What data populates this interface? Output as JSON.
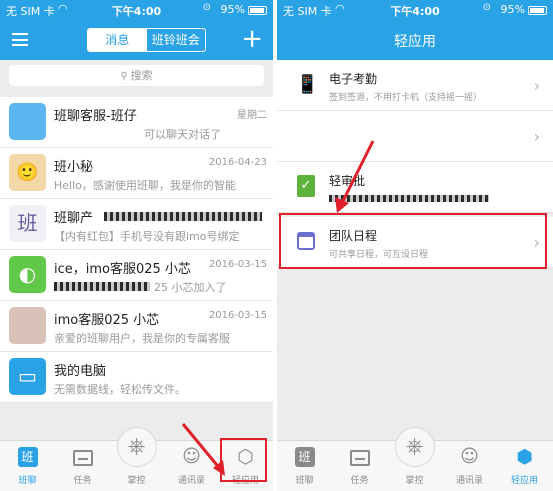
{
  "status_bar": {
    "carrier": "无 SIM 卡",
    "time": "下午4:00",
    "battery": "95%"
  },
  "left": {
    "tabs": [
      "消息",
      "班铃班会"
    ],
    "search_placeholder": "搜索",
    "chats": [
      {
        "name": "班聊客服-班仔",
        "date": "星期二",
        "preview": "可以聊天对话了",
        "avatar_color": "#5bb6ef",
        "avatar_text": ""
      },
      {
        "name": "班小秘",
        "date": "2016-04-23",
        "preview": "Hello，感谢使用班聊，我是你的智能",
        "avatar_color": "#f4d9a8",
        "avatar_text": "🙂"
      },
      {
        "name": "班聊产",
        "date": "",
        "preview": "【内有红包】手机号没有跟imo号绑定",
        "avatar_color": "#f2f0f6",
        "avatar_text": "班"
      },
      {
        "name": "ice，imo客服025 小芯",
        "date": "2016-03-15",
        "preview": "25 小芯加入了",
        "avatar_color": "#61c84a",
        "avatar_text": "◐"
      },
      {
        "name": "imo客服025 小芯",
        "date": "2016-03-15",
        "preview": "亲爱的班聊用户，我是你的专属客服",
        "avatar_color": "#d9c3b8",
        "avatar_text": ""
      },
      {
        "name": "我的电脑",
        "date": "",
        "preview": "无需数据线，轻松传文件。",
        "avatar_color": "#2aa2e6",
        "avatar_text": "▭"
      }
    ],
    "bottom_tabs": [
      "班聊",
      "任务",
      "掌控",
      "通讯录",
      "轻应用"
    ]
  },
  "right": {
    "title": "轻应用",
    "apps": [
      {
        "title": "电子考勤",
        "desc": "签到签退，不用打卡机（支持摇一摇）"
      },
      {
        "title": "",
        "desc": ""
      },
      {
        "title": "轻审批",
        "desc": ""
      },
      {
        "title": "团队日程",
        "desc": "可共享日程，可互设日程"
      }
    ],
    "bottom_tabs": [
      "班聊",
      "任务",
      "掌控",
      "通讯录",
      "轻应用"
    ]
  },
  "colors": {
    "accent": "#2aa2e6",
    "highlight": "#e0202a"
  }
}
